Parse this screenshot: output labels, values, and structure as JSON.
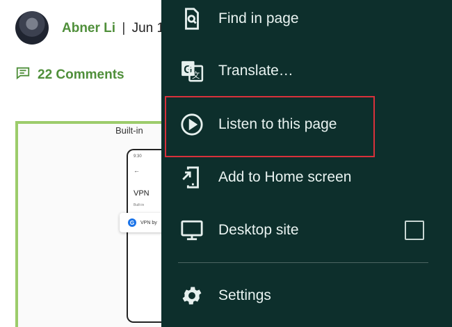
{
  "article": {
    "author": "Abner Li",
    "separator": "|",
    "date_partial": "Jun 1",
    "comments": "22 Comments",
    "figure": {
      "title_partial": "Built-in",
      "phone_time": "9:30",
      "phone_back": "←",
      "vpn_title": "VPN",
      "vpn_subtitle": "Built-in",
      "vpn_chip_badge": "G",
      "vpn_chip_text": "VPN by"
    }
  },
  "menu": {
    "items": [
      {
        "label": "Find in page",
        "icon": "find-in-page-icon"
      },
      {
        "label": "Translate…",
        "icon": "translate-icon"
      },
      {
        "label": "Listen to this page",
        "icon": "play-circle-icon",
        "highlighted": true
      },
      {
        "label": "Add to Home screen",
        "icon": "add-to-home-screen-icon"
      },
      {
        "label": "Desktop site",
        "icon": "desktop-icon",
        "checkbox_checked": false
      },
      {
        "label": "Settings",
        "icon": "gear-icon"
      }
    ]
  },
  "colors": {
    "menu_background": "#0d2f2c",
    "menu_text": "#e9f3f1",
    "accent_green": "#4f8f3a",
    "highlight_red": "#d9313b"
  }
}
